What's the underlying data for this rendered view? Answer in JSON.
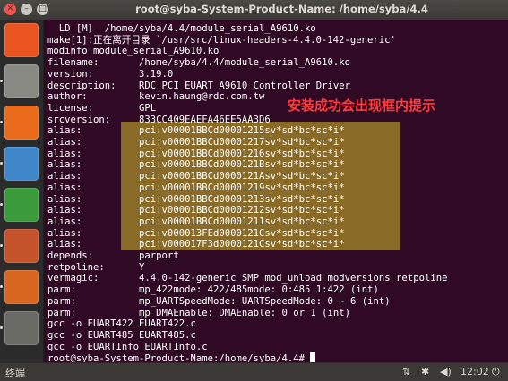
{
  "window": {
    "title": "root@syba-System-Product-Name: /home/syba/4.4",
    "close_glyph": "✕",
    "min_glyph": "–",
    "max_glyph": "□"
  },
  "launcher": {
    "items": [
      {
        "name": "ubuntu-dash-icon",
        "color": "#e95420"
      },
      {
        "name": "files-icon",
        "color": "#8a8a84"
      },
      {
        "name": "firefox-icon",
        "color": "#e86a1a"
      },
      {
        "name": "libreoffice-writer-icon",
        "color": "#3f87c8"
      },
      {
        "name": "libreoffice-calc-icon",
        "color": "#3b9a3b"
      },
      {
        "name": "libreoffice-impress-icon",
        "color": "#c4532b"
      },
      {
        "name": "software-center-icon",
        "color": "#d86520"
      },
      {
        "name": "system-settings-icon",
        "color": "#6b6b66"
      }
    ]
  },
  "terminal": {
    "lines": [
      "  LD [M]  /home/syba/4.4/module_serial_A9610.ko",
      "make[1]:正在离开目录 `/usr/src/linux-headers-4.4.0-142-generic'",
      "modinfo module_serial_A9610.ko",
      "filename:       /home/syba/4.4/module_serial_A9610.ko",
      "version:        3.19.0",
      "description:    RDC PCI EUART A9610 Controller Driver",
      "author:         kevin.haung@rdc.com.tw",
      "license:        GPL",
      "srcversion:     833CC409EAEFA46EE5AA3D6",
      "alias:          pci:v00001BBCd00001215sv*sd*bc*sc*i*",
      "alias:          pci:v00001BBCd00001217sv*sd*bc*sc*i*",
      "alias:          pci:v00001BBCd00001216sv*sd*bc*sc*i*",
      "alias:          pci:v00001BBCd0000121Bsv*sd*bc*sc*i*",
      "alias:          pci:v00001BBCd0000121Asv*sd*bc*sc*i*",
      "alias:          pci:v00001BBCd00001219sv*sd*bc*sc*i*",
      "alias:          pci:v00001BBCd00001213sv*sd*bc*sc*i*",
      "alias:          pci:v00001BBCd00001212sv*sd*bc*sc*i*",
      "alias:          pci:v00001BBCd00001211sv*sd*bc*sc*i*",
      "alias:          pci:v000013FEd0000121Csv*sd*bc*sc*i*",
      "alias:          pci:v000017F3d0000121Csv*sd*bc*sc*i*",
      "depends:        parport",
      "retpoline:      Y",
      "vermagic:       4.4.0-142-generic SMP mod_unload modversions retpoline",
      "parm:           mp_422mode: 422/485mode: 0:485 1:422 (int)",
      "parm:           mp_UARTSpeedMode: UARTSpeedMode: 0 ~ 6 (int)",
      "parm:           mp_DMAEnable: DMAEnable: 0 or 1 (int)",
      "gcc -o EUART422 EUART422.c",
      "gcc -o EUART485 EUART485.c",
      "gcc -o EUARTInfo EUARTInfo.c"
    ],
    "prompt": "root@syba-System-Product-Name:/home/syba/4.4# ",
    "highlight_color": "#8a6a27",
    "background": "#300a24"
  },
  "annotation": {
    "text": "安装成功会出现框内提示",
    "color": "#ff3a3a"
  },
  "taskbar": {
    "app_label": "终端",
    "clock": "12:02",
    "network_icon": "network-icon",
    "bluetooth_icon": "bluetooth-icon",
    "volume_icon": "volume-icon",
    "power_icon": "power-icon"
  }
}
